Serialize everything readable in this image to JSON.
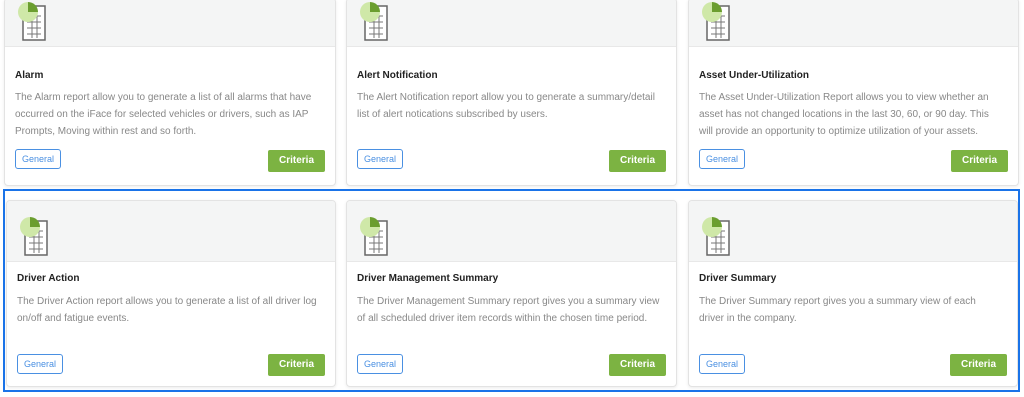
{
  "report_cards": [
    {
      "title": "Alarm",
      "description": "The Alarm report allow you to generate a list of all alarms that have occurred on the iFace for selected vehicles or drivers, such as IAP Prompts, Moving within rest and so forth.",
      "tag": "General",
      "button": "Criteria"
    },
    {
      "title": "Alert Notification",
      "description": "The Alert Notification report allow you to generate a summary/detail list of alert notications subscribed by users.",
      "tag": "General",
      "button": "Criteria"
    },
    {
      "title": "Asset Under-Utilization",
      "description": "The Asset Under-Utilization Report allows you to view whether an asset has not changed locations in the last 30, 60, or 90 day. This will provide an opportunity to optimize utilization of your assets.",
      "tag": "General",
      "button": "Criteria"
    },
    {
      "title": "Driver Action",
      "description": "The Driver Action report allows you to generate a list of all driver log on/off and fatigue events.",
      "tag": "General",
      "button": "Criteria"
    },
    {
      "title": "Driver Management Summary",
      "description": "The Driver Management Summary report gives you a summary view of all scheduled driver item records within the chosen time period.",
      "tag": "General",
      "button": "Criteria"
    },
    {
      "title": "Driver Summary",
      "description": "The Driver Summary report gives you a summary view of each driver in the company.",
      "tag": "General",
      "button": "Criteria"
    }
  ],
  "icon": "report-spreadsheet-icon",
  "colors": {
    "accent_green": "#7cb342",
    "tag_blue": "#4a90e2",
    "selection_blue": "#1a73e8"
  }
}
